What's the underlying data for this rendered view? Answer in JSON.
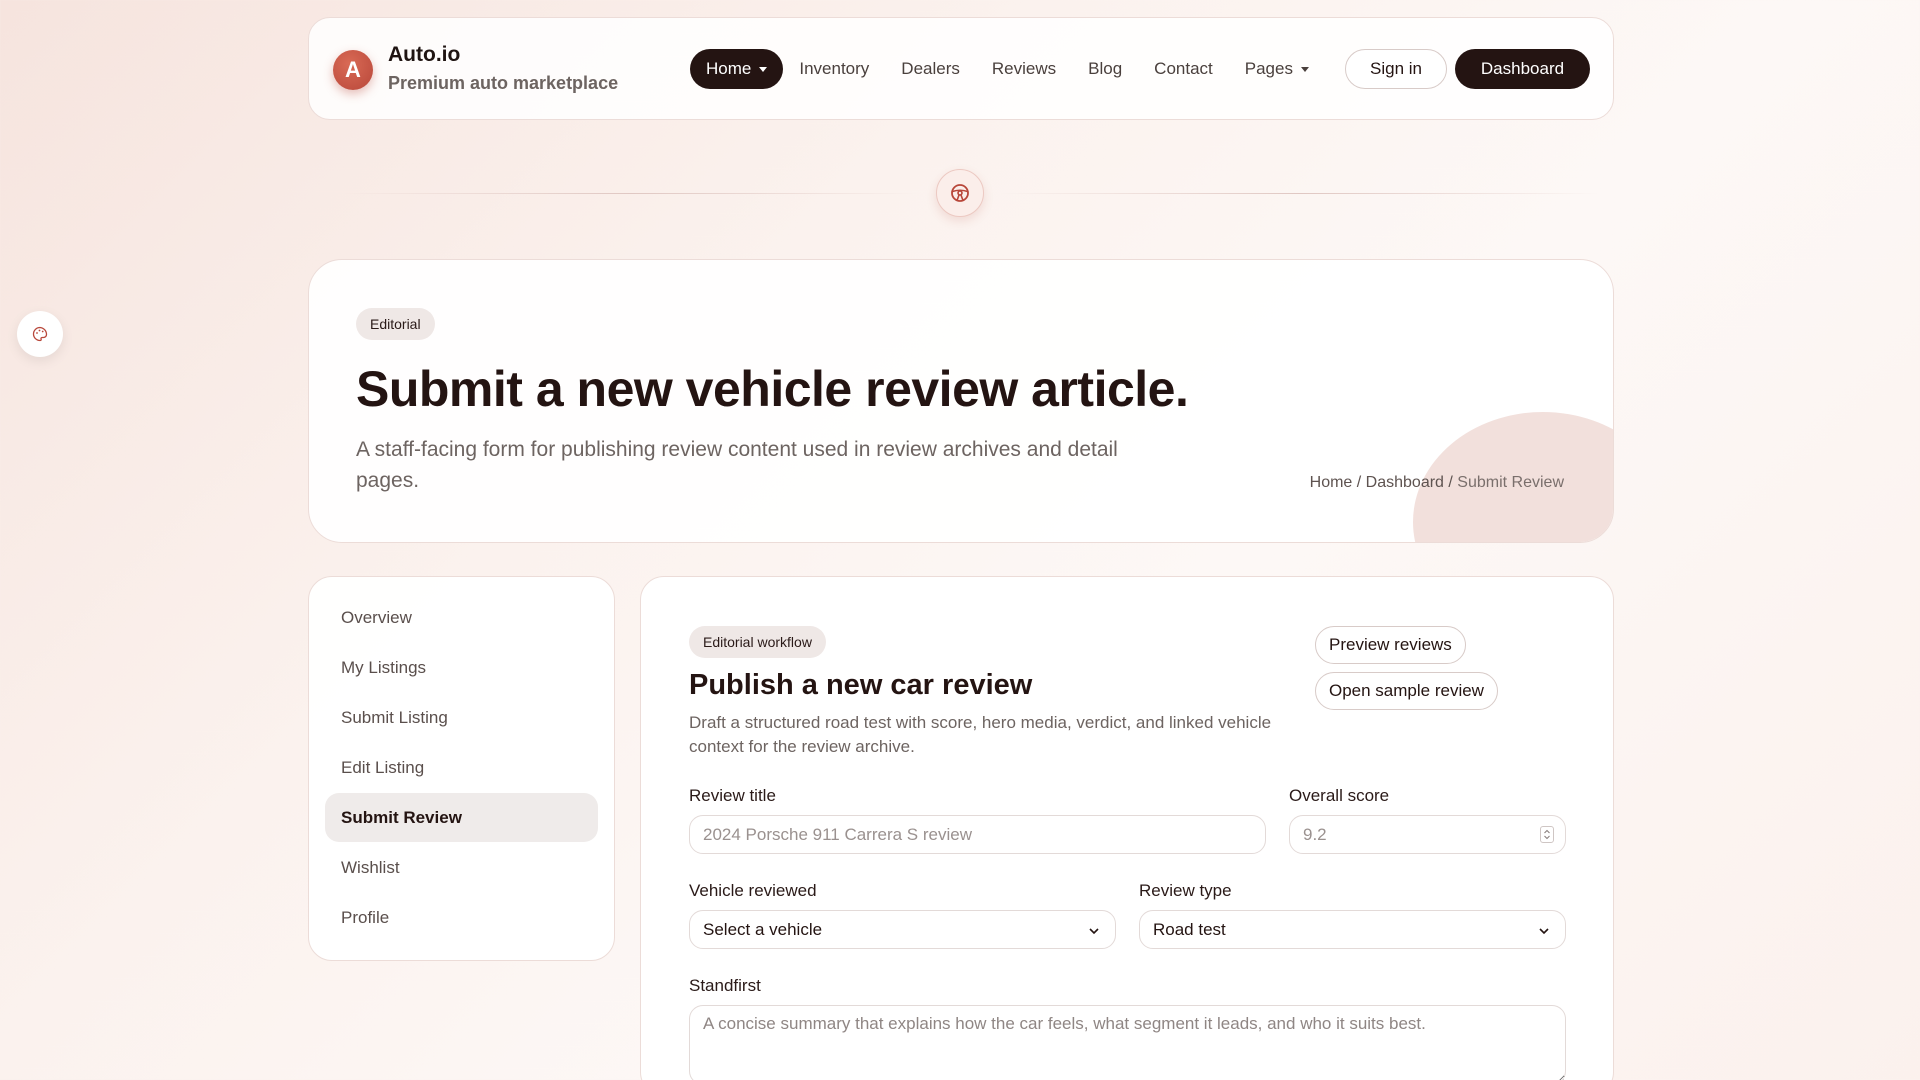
{
  "brand": {
    "logo_letter": "A",
    "name": "Auto.io",
    "tagline": "Premium auto marketplace"
  },
  "nav": {
    "home": "Home",
    "items": [
      "Inventory",
      "Dealers",
      "Reviews",
      "Blog",
      "Contact",
      "Pages"
    ],
    "sign_in": "Sign in",
    "dashboard": "Dashboard"
  },
  "hero": {
    "badge": "Editorial",
    "title": "Submit a new vehicle review article.",
    "subtitle": "A staff-facing form for publishing review content used in review archives and detail pages.",
    "breadcrumb": {
      "home": "Home",
      "sep1": " / ",
      "dashboard": "Dashboard",
      "sep2": " / ",
      "current": "Submit Review"
    }
  },
  "sidebar": {
    "items": [
      {
        "label": "Overview"
      },
      {
        "label": "My Listings"
      },
      {
        "label": "Submit Listing"
      },
      {
        "label": "Edit Listing"
      },
      {
        "label": "Submit Review",
        "active": true
      },
      {
        "label": "Wishlist"
      },
      {
        "label": "Profile"
      }
    ]
  },
  "form": {
    "badge": "Editorial workflow",
    "title": "Publish a new car review",
    "description": "Draft a structured road test with score, hero media, verdict, and linked vehicle context for the review archive.",
    "preview_button": "Preview reviews",
    "sample_button": "Open sample review",
    "review_title": {
      "label": "Review title",
      "placeholder": "2024 Porsche 911 Carrera S review"
    },
    "overall_score": {
      "label": "Overall score",
      "placeholder": "9.2"
    },
    "vehicle": {
      "label": "Vehicle reviewed",
      "value": "Select a vehicle"
    },
    "review_type": {
      "label": "Review type",
      "value": "Road test"
    },
    "standfirst": {
      "label": "Standfirst",
      "placeholder": "A concise summary that explains how the car feels, what segment it leads, and who it suits best."
    }
  },
  "colors": {
    "accent": "#b8473a",
    "dark": "#241412"
  },
  "icons": {
    "divider": "steering-wheel-icon",
    "floating": "palette-icon"
  }
}
